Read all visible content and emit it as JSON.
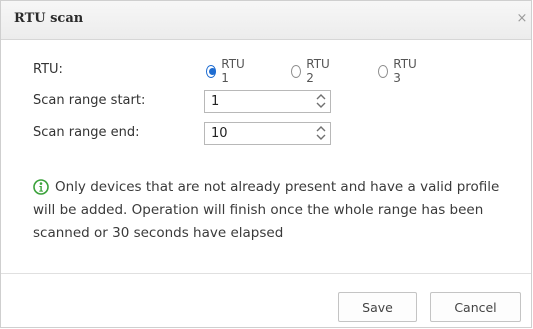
{
  "dialog": {
    "title": "RTU scan",
    "close_glyph": "×"
  },
  "form": {
    "rtu_label": "RTU:",
    "rtu_options": [
      {
        "label": "RTU 1",
        "checked": true
      },
      {
        "label": "RTU 2",
        "checked": false
      },
      {
        "label": "RTU 3",
        "checked": false
      }
    ],
    "start_label": "Scan range start:",
    "start_value": "1",
    "end_label": "Scan range end:",
    "end_value": "10"
  },
  "info": {
    "icon": "info-icon",
    "text": "Only devices that are not already present and have a valid profile",
    "text_line2": "will be added. Operation will finish once the whole range has been",
    "text_line3": "scanned or 30 seconds have elapsed"
  },
  "buttons": {
    "save": "Save",
    "cancel": "Cancel"
  },
  "colors": {
    "accent": "#1e6cd1",
    "info_icon": "#3aa13a"
  }
}
